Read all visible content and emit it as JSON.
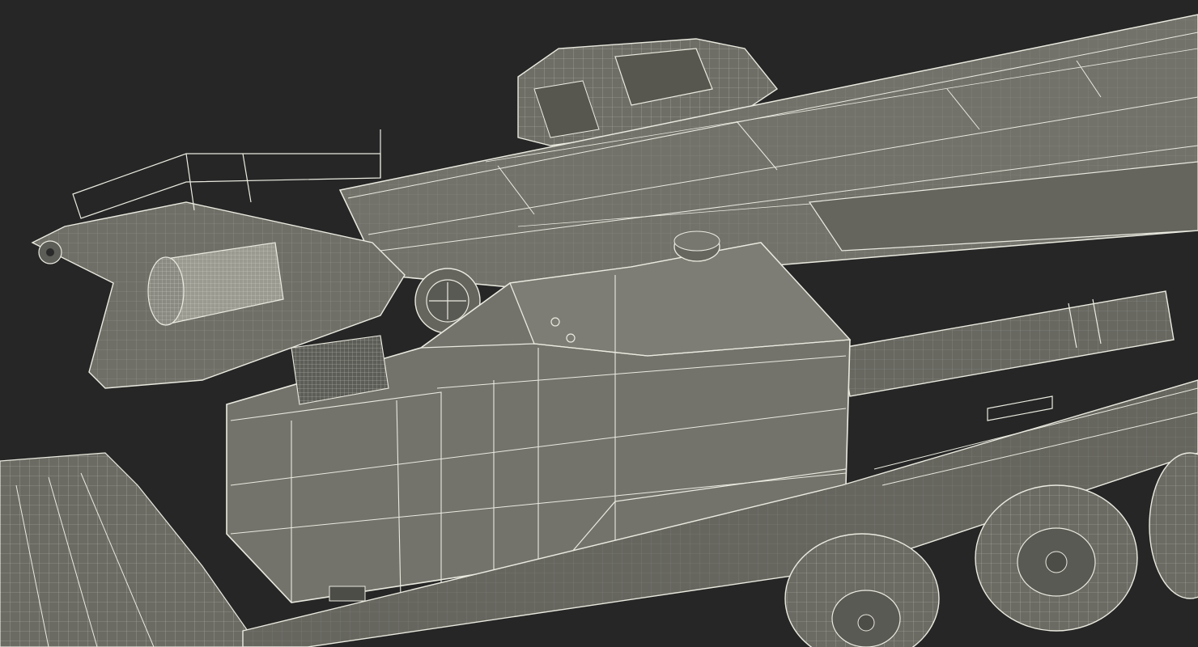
{
  "scene": {
    "background_color": "#262626",
    "surface_color": "#6f6f68",
    "surface_dark": "#5d5d57",
    "surface_light": "#818179",
    "wire_color": "#eaeae0"
  }
}
